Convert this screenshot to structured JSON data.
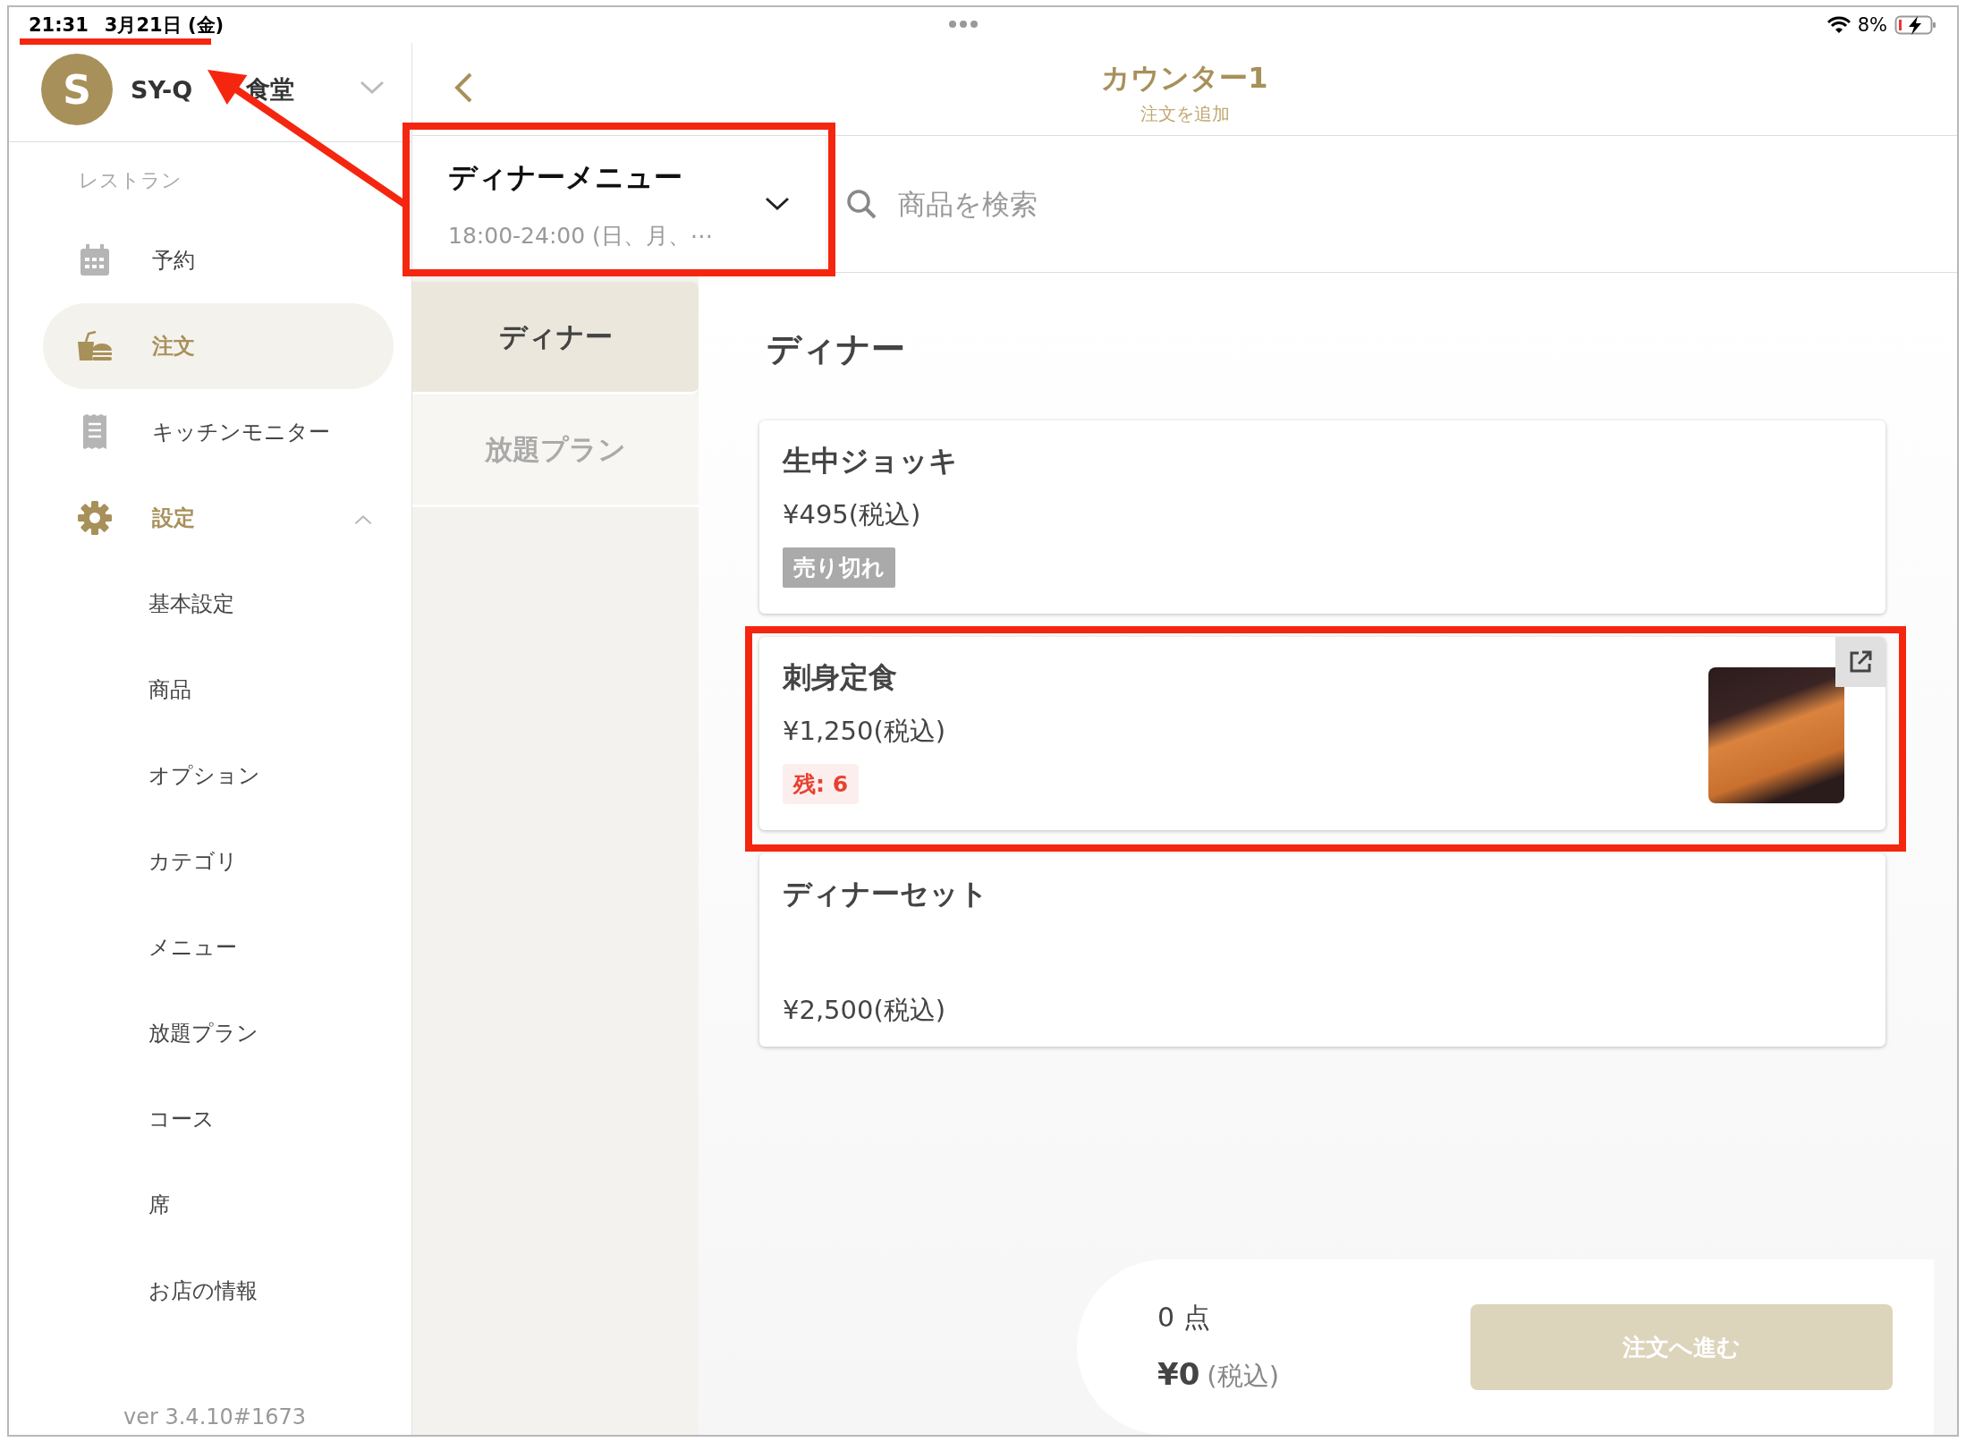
{
  "status_bar": {
    "time": "21:31",
    "date": "3月21日 (金)",
    "battery": "8%"
  },
  "sidebar": {
    "avatar_letter": "S",
    "store_name_parts": [
      "SY-Q",
      "食堂"
    ],
    "section_label": "レストラン",
    "items": [
      {
        "label": "予約",
        "selected": false
      },
      {
        "label": "注文",
        "selected": true
      },
      {
        "label": "キッチンモニター",
        "selected": false
      },
      {
        "label": "設定",
        "selected": false,
        "expanded": true,
        "children": [
          {
            "label": "基本設定"
          },
          {
            "label": "商品"
          },
          {
            "label": "オプション"
          },
          {
            "label": "カテゴリ"
          },
          {
            "label": "メニュー"
          },
          {
            "label": "放題プラン"
          },
          {
            "label": "コース"
          },
          {
            "label": "席"
          },
          {
            "label": "お店の情報"
          }
        ]
      }
    ],
    "version": "ver 3.4.10#1673"
  },
  "header": {
    "title": "カウンター1",
    "subtitle": "注文を追加"
  },
  "menu_selector": {
    "name": "ディナーメニュー",
    "hours": "18:00-24:00 (日、月、⋯"
  },
  "search": {
    "placeholder": "商品を検索"
  },
  "categories": [
    {
      "label": "ディナー",
      "selected": true
    },
    {
      "label": "放題プラン",
      "selected": false
    }
  ],
  "section_title": "ディナー",
  "products": [
    {
      "name": "生中ジョッキ",
      "price": "¥495(税込)",
      "badge": {
        "kind": "sold_out",
        "text": "売り切れ"
      },
      "photo": false
    },
    {
      "name": "刺身定食",
      "price": "¥1,250(税込)",
      "badge": {
        "kind": "stock",
        "text": "残: 6"
      },
      "photo": true
    },
    {
      "name": "ディナーセット",
      "price": "¥2,500(税込)",
      "photo": false
    }
  ],
  "cart": {
    "count": "0 点",
    "total": "¥0",
    "tax_note": "(税込)",
    "button": "注文へ進む",
    "disabled": true
  }
}
